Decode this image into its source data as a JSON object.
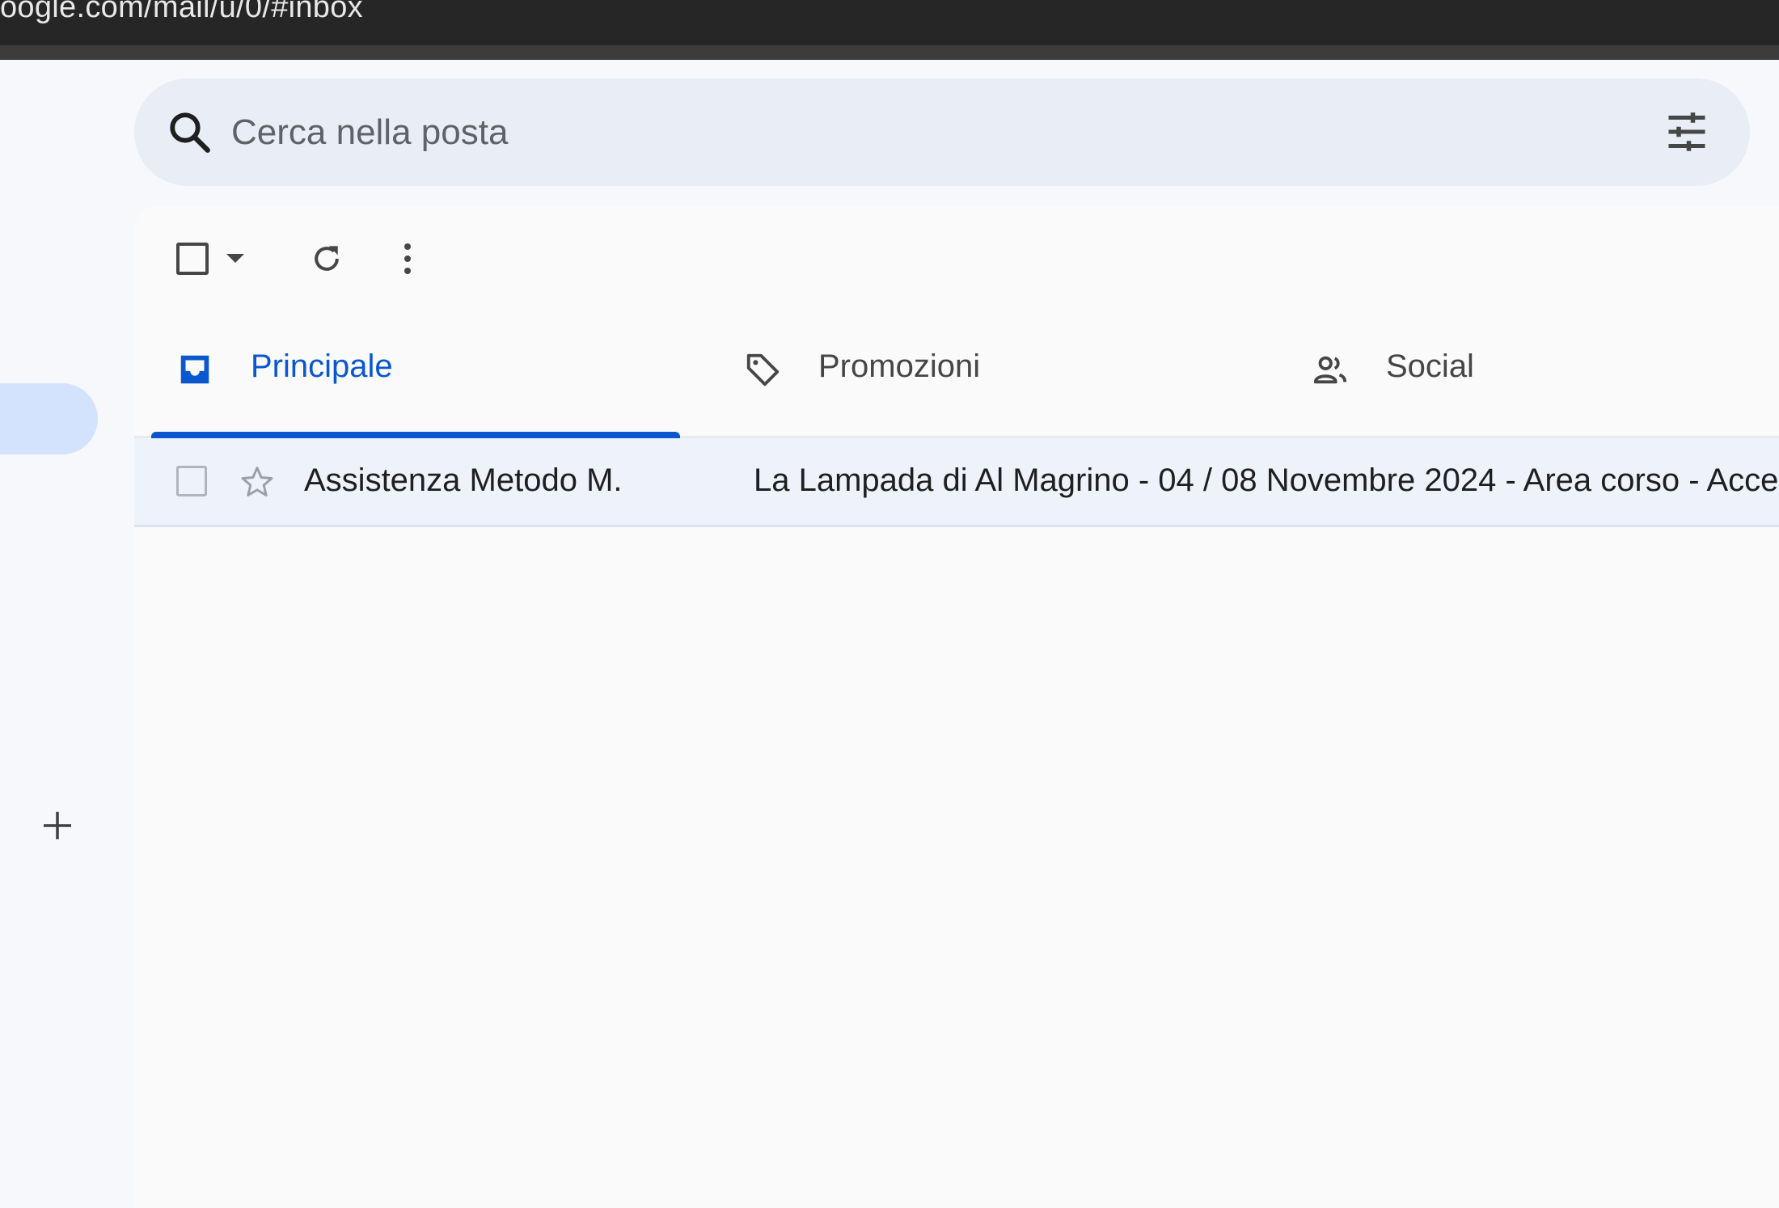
{
  "browser": {
    "url": "oogle.com/mail/u/0/#inbox"
  },
  "sidebar": {
    "compose_icon": "plus-icon"
  },
  "search": {
    "placeholder": "Cerca nella posta",
    "value": "",
    "filter_icon": "tune-icon"
  },
  "toolbar": {
    "select_all_checked": false,
    "icons": [
      "checkbox",
      "caret-down-icon",
      "refresh-icon",
      "more-vert-icon"
    ]
  },
  "tabs": [
    {
      "label": "Principale",
      "icon": "inbox-icon",
      "active": true
    },
    {
      "label": "Promozioni",
      "icon": "tag-icon",
      "active": false
    },
    {
      "label": "Social",
      "icon": "people-icon",
      "active": false
    }
  ],
  "emails": [
    {
      "sender": "Assistenza Metodo M.",
      "subject": "La Lampada di Al Magrino - 04 / 08 Novembre 2024 - Area corso - Acce",
      "starred": false,
      "selected": false
    }
  ],
  "colors": {
    "accent": "#0b57d0",
    "search_bg": "#e9eef6",
    "active_nav": "#d3e3fd",
    "row_bg": "#eef2fb",
    "page_bg": "#f6f8fc"
  }
}
